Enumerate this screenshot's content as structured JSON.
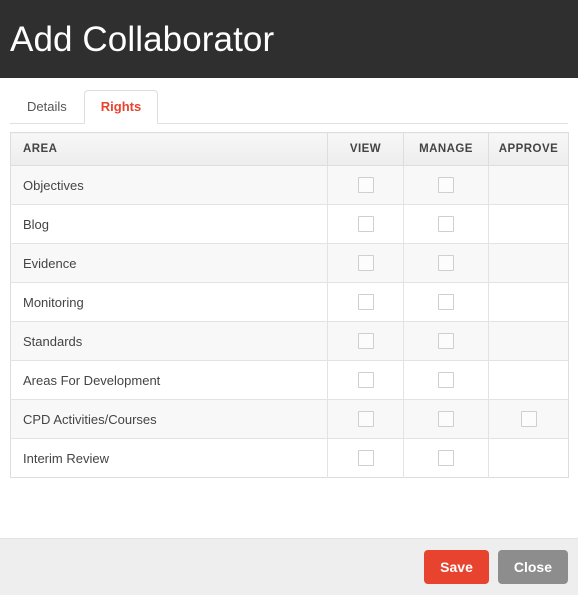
{
  "dialog": {
    "title": "Add Collaborator"
  },
  "tabs": [
    {
      "label": "Details",
      "active": false,
      "name": "tab-details"
    },
    {
      "label": "Rights",
      "active": true,
      "name": "tab-rights"
    }
  ],
  "table": {
    "columns": [
      {
        "label": "AREA",
        "align": "left"
      },
      {
        "label": "VIEW",
        "align": "center"
      },
      {
        "label": "MANAGE",
        "align": "center"
      },
      {
        "label": "APPROVE",
        "align": "center"
      }
    ],
    "rows": [
      {
        "area": "Objectives",
        "view": true,
        "manage": true,
        "approve": false,
        "view_checked": false,
        "manage_checked": false,
        "approve_checked": false
      },
      {
        "area": "Blog",
        "view": true,
        "manage": true,
        "approve": false,
        "view_checked": false,
        "manage_checked": false,
        "approve_checked": false
      },
      {
        "area": "Evidence",
        "view": true,
        "manage": true,
        "approve": false,
        "view_checked": false,
        "manage_checked": false,
        "approve_checked": false
      },
      {
        "area": "Monitoring",
        "view": true,
        "manage": true,
        "approve": false,
        "view_checked": false,
        "manage_checked": false,
        "approve_checked": false
      },
      {
        "area": "Standards",
        "view": true,
        "manage": true,
        "approve": false,
        "view_checked": false,
        "manage_checked": false,
        "approve_checked": false
      },
      {
        "area": "Areas For Development",
        "view": true,
        "manage": true,
        "approve": false,
        "view_checked": false,
        "manage_checked": false,
        "approve_checked": false
      },
      {
        "area": "CPD Activities/Courses",
        "view": true,
        "manage": true,
        "approve": true,
        "view_checked": false,
        "manage_checked": false,
        "approve_checked": false
      },
      {
        "area": "Interim Review",
        "view": true,
        "manage": true,
        "approve": false,
        "view_checked": false,
        "manage_checked": false,
        "approve_checked": false
      }
    ]
  },
  "footer": {
    "save_label": "Save",
    "close_label": "Close"
  },
  "colors": {
    "titlebar_bg": "#2f2f2f",
    "accent": "#e8432e",
    "save_bg": "#e8432e",
    "close_bg": "#8d8d8d",
    "footer_bg": "#eeeeee",
    "stripe_bg": "#f8f8f8",
    "border": "#dddddd"
  }
}
